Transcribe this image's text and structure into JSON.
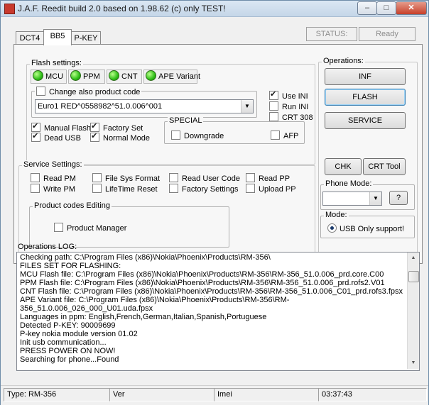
{
  "window": {
    "title": "J.A.F. Reedit build 2.0 based on 1.98.62 (c) only TEST!",
    "min": "–",
    "max": "□",
    "close": "✕"
  },
  "tabs": [
    {
      "label": "DCT4"
    },
    {
      "label": "BB5"
    },
    {
      "label": "P-KEY"
    }
  ],
  "status": {
    "label": "STATUS:",
    "value": "Ready"
  },
  "flash_settings": {
    "title": "Flash settings:",
    "leds": [
      "MCU",
      "PPM",
      "CNT",
      "APE Variant"
    ],
    "change_product_code": "Change also product code",
    "product_code": "Euro1 RED^0558982^51.0.006^001",
    "use_ini": "Use INI",
    "run_ini": "Run INI",
    "crt308": "CRT 308",
    "manual_flash": "Manual Flash",
    "factory_set": "Factory Set",
    "dead_usb": "Dead USB",
    "normal_mode": "Normal Mode",
    "special": {
      "title": "SPECIAL",
      "downgrade": "Downgrade",
      "afp": "AFP"
    }
  },
  "service_settings": {
    "title": "Service Settings:",
    "items": [
      "Read PM",
      "File Sys Format",
      "Read User Code",
      "Read PP",
      "Write PM",
      "LifeTime Reset",
      "Factory Settings",
      "Upload PP"
    ]
  },
  "product_codes": {
    "title": "Product codes Editing",
    "manager": "Product Manager"
  },
  "operations": {
    "title": "Operations:",
    "inf": "INF",
    "flash": "FLASH",
    "service": "SERVICE",
    "chk": "CHK",
    "crt_tool": "CRT Tool"
  },
  "phone_mode": {
    "title": "Phone Mode:",
    "value": "",
    "help": "?"
  },
  "mode": {
    "title": "Mode:",
    "usb_only": "USB Only support!"
  },
  "log": {
    "title": "Operations LOG:",
    "lines": [
      "Checking path: C:\\Program Files (x86)\\Nokia\\Phoenix\\Products\\RM-356\\",
      "FILES SET FOR FLASHING:",
      "MCU Flash file: C:\\Program Files (x86)\\Nokia\\Phoenix\\Products\\RM-356\\RM-356_51.0.006_prd.core.C00",
      "PPM Flash file: C:\\Program Files (x86)\\Nokia\\Phoenix\\Products\\RM-356\\RM-356_51.0.006_prd.rofs2.V01",
      "CNT Flash file: C:\\Program Files (x86)\\Nokia\\Phoenix\\Products\\RM-356\\RM-356_51.0.006_C01_prd.rofs3.fpsx",
      "APE Variant file: C:\\Program Files (x86)\\Nokia\\Phoenix\\Products\\RM-356\\RM-",
      "356_51.0.006_026_000_U01.uda.fpsx",
      "Languages in ppm: English,French,German,Italian,Spanish,Portuguese",
      "Detected P-KEY: 90009699",
      "P-key nokia module version 01.02",
      "Init usb communication...",
      "PRESS POWER ON NOW!",
      "Searching for phone...Found"
    ]
  },
  "statusbar": {
    "type": "Type: RM-356",
    "ver": "Ver",
    "imei": "Imei",
    "time": "03:37:43"
  }
}
